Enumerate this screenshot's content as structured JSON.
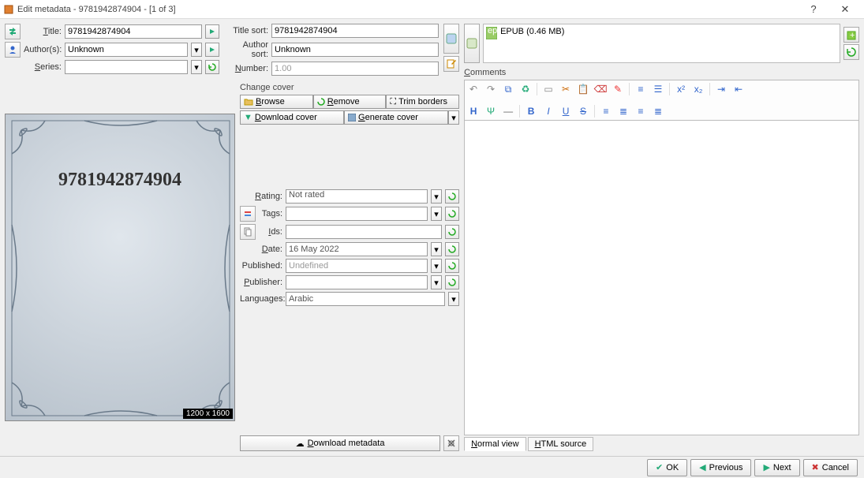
{
  "window": {
    "title": "Edit metadata - 9781942874904 - [1 of 3]"
  },
  "fields": {
    "title_label": "Title:",
    "title": "9781942874904",
    "authors_label": "Author(s):",
    "authors": "Unknown",
    "series_label": "Series:",
    "series": "",
    "title_sort_label": "Title sort:",
    "title_sort": "9781942874904",
    "author_sort_label": "Author sort:",
    "author_sort": "Unknown",
    "number_label": "Number:",
    "number": "1.00"
  },
  "cover": {
    "section_label": "Change cover",
    "browse": "Browse",
    "remove": "Remove",
    "trim": "Trim borders",
    "download": "Download cover",
    "generate": "Generate cover",
    "dimensions": "1200 x 1600",
    "book_title_on_cover": "9781942874904"
  },
  "meta": {
    "rating_label": "Rating:",
    "rating": "Not rated",
    "tags_label": "Tags:",
    "tags": "",
    "ids_label": "Ids:",
    "ids": "",
    "date_label": "Date:",
    "date": "16 May 2022",
    "published_label": "Published:",
    "published": "Undefined",
    "publisher_label": "Publisher:",
    "publisher": "",
    "languages_label": "Languages:",
    "languages": "Arabic"
  },
  "download_metadata": "Download metadata",
  "formats": {
    "item": "EPUB (0.46 MB)"
  },
  "comments": {
    "label": "Comments",
    "normal_tab": "Normal view",
    "html_tab": "HTML source"
  },
  "footer": {
    "ok": "OK",
    "previous": "Previous",
    "next": "Next",
    "cancel": "Cancel"
  }
}
